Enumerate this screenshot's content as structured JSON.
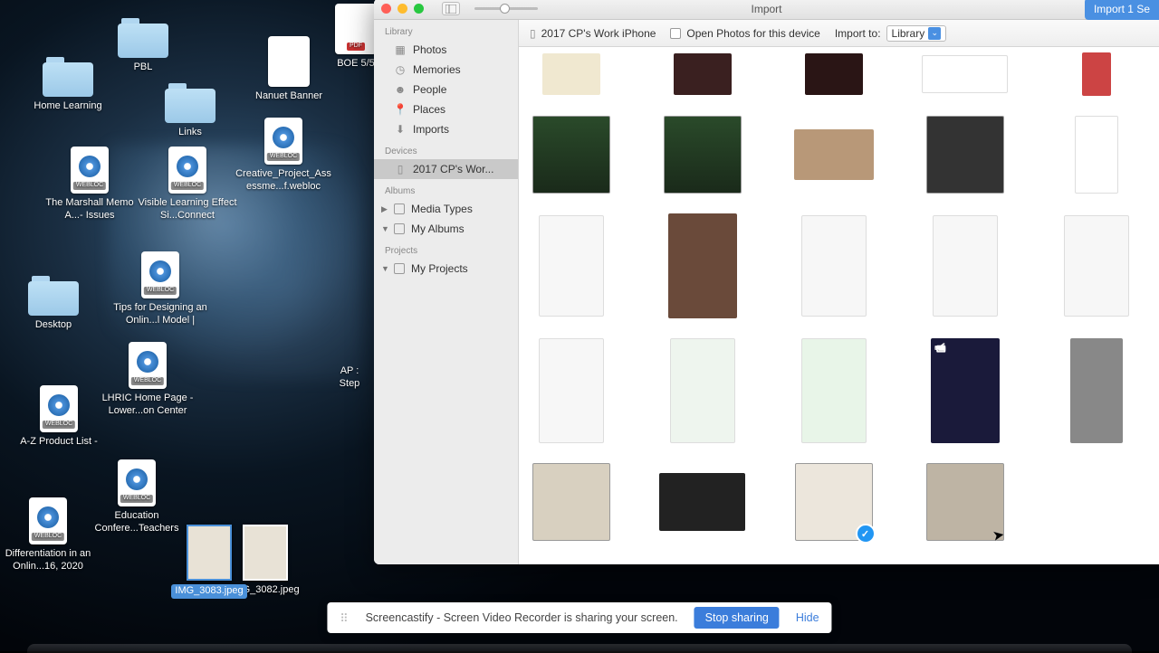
{
  "desktop_icons": {
    "home_learning": "Home Learning",
    "pbl": "PBL",
    "links": "Links",
    "nanuet_banner": "Nanuet Banner",
    "boe": "BOE 5/5",
    "creative": "Creative_Project_Assessme...f.webloc",
    "marshall": "The Marshall Memo A...- Issues",
    "visible": "Visible Learning Effect Si...Connect",
    "desktop": "Desktop",
    "tips": "Tips for Designing an Onlin...l Model |",
    "az": "A-Z Product List -",
    "lhric": "LHRIC Home Page - Lower...on Center",
    "edu": "Education Confere...Teachers",
    "diff": "Differentiation in an Onlin...16, 2020",
    "ap": "AP :\nStep",
    "img3082": "IMG_3082.jpeg",
    "img3083": "IMG_3083.jpeg",
    "webloc_tag": "WEBLOC",
    "pdf_tag": "PDF"
  },
  "window": {
    "title": "Import",
    "import_button": "Import 1 Se",
    "device_name": "2017 CP's Work iPhone",
    "open_for_device": "Open Photos for this device",
    "import_to_label": "Import to:",
    "import_to_value": "Library"
  },
  "sidebar": {
    "library": "Library",
    "photos": "Photos",
    "memories": "Memories",
    "people": "People",
    "places": "Places",
    "imports": "Imports",
    "devices": "Devices",
    "device_item": "2017 CP's Wor...",
    "albums": "Albums",
    "media_types": "Media Types",
    "my_albums": "My Albums",
    "projects": "Projects",
    "my_projects": "My Projects"
  },
  "cast": {
    "text": "Screencastify - Screen Video Recorder is sharing your screen.",
    "stop": "Stop sharing",
    "hide": "Hide"
  }
}
